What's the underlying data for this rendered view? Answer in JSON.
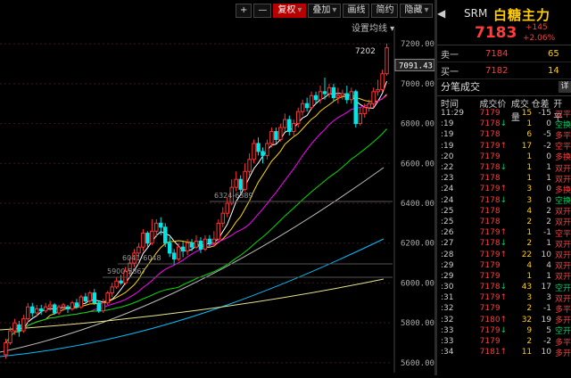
{
  "toolbar": {
    "plus": "+",
    "minus": "—",
    "fuquan": "复权",
    "diejia": "叠加",
    "huaxian": "画线",
    "jianyue": "简约",
    "yincang": "隐藏",
    "help": "?"
  },
  "chart": {
    "settings_label": "设置均线",
    "y_ticks": [
      "7200.00",
      "7000.00",
      "6800.00",
      "6600.00",
      "6400.00",
      "6200.00",
      "6000.00",
      "5800.00",
      "5600.00"
    ],
    "current_price_tag": "7091.43",
    "high_label": "7202",
    "annotations": [
      "6324-6389",
      "6041-6048",
      "5900-5867"
    ],
    "colors": {
      "up": "#ff3333",
      "down": "#00e5e5",
      "ma5": "#ffffff",
      "ma10": "#ffd700",
      "ma20": "#ff00ff",
      "ma60": "#00dd00",
      "ma120": "#bbbbbb",
      "ma250": "#00bfff",
      "ma500": "#e6e68c"
    }
  },
  "chart_data": {
    "type": "candlestick",
    "ylim": [
      5550,
      7250
    ],
    "candles": [
      [
        5640,
        5700,
        5620,
        5720
      ],
      [
        5700,
        5760,
        5690,
        5780
      ],
      [
        5760,
        5800,
        5740,
        5820
      ],
      [
        5790,
        5760,
        5730,
        5810
      ],
      [
        5760,
        5820,
        5750,
        5840
      ],
      [
        5820,
        5880,
        5800,
        5900
      ],
      [
        5880,
        5850,
        5830,
        5900
      ],
      [
        5850,
        5870,
        5830,
        5890
      ],
      [
        5870,
        5860,
        5840,
        5890
      ],
      [
        5860,
        5880,
        5850,
        5900
      ],
      [
        5880,
        5890,
        5860,
        5910
      ],
      [
        5890,
        5850,
        5840,
        5900
      ],
      [
        5850,
        5880,
        5840,
        5890
      ],
      [
        5880,
        5890,
        5860,
        5900
      ],
      [
        5880,
        5870,
        5850,
        5890
      ],
      [
        5870,
        5900,
        5860,
        5910
      ],
      [
        5900,
        5880,
        5870,
        5920
      ],
      [
        5880,
        5930,
        5870,
        5940
      ],
      [
        5930,
        5910,
        5900,
        5950
      ],
      [
        5910,
        5950,
        5900,
        5960
      ],
      [
        5950,
        5900,
        5890,
        5970
      ],
      [
        5900,
        5860,
        5850,
        5910
      ],
      [
        5860,
        5900,
        5850,
        5920
      ],
      [
        5900,
        5950,
        5890,
        5960
      ],
      [
        5950,
        5980,
        5930,
        6000
      ],
      [
        5980,
        6010,
        5970,
        6030
      ],
      [
        6010,
        6000,
        5990,
        6040
      ],
      [
        6000,
        6060,
        5990,
        6080
      ],
      [
        6060,
        6100,
        6040,
        6130
      ],
      [
        6100,
        6150,
        6080,
        6170
      ],
      [
        6150,
        6180,
        6130,
        6200
      ],
      [
        6180,
        6250,
        6160,
        6270
      ],
      [
        6250,
        6200,
        6180,
        6260
      ],
      [
        6200,
        6260,
        6190,
        6320
      ],
      [
        6260,
        6300,
        6230,
        6320
      ],
      [
        6300,
        6280,
        6240,
        6330
      ],
      [
        6280,
        6200,
        6180,
        6300
      ],
      [
        6200,
        6150,
        6130,
        6230
      ],
      [
        6150,
        6120,
        6090,
        6170
      ],
      [
        6120,
        6180,
        6110,
        6200
      ],
      [
        6180,
        6160,
        6130,
        6210
      ],
      [
        6160,
        6200,
        6140,
        6220
      ],
      [
        6200,
        6180,
        6160,
        6220
      ],
      [
        6180,
        6210,
        6170,
        6240
      ],
      [
        6210,
        6170,
        6150,
        6230
      ],
      [
        6170,
        6220,
        6160,
        6240
      ],
      [
        6220,
        6200,
        6180,
        6240
      ],
      [
        6200,
        6220,
        6180,
        6260
      ],
      [
        6220,
        6300,
        6210,
        6320
      ],
      [
        6300,
        6350,
        6280,
        6380
      ],
      [
        6350,
        6400,
        6330,
        6430
      ],
      [
        6400,
        6480,
        6390,
        6520
      ],
      [
        6480,
        6520,
        6460,
        6560
      ],
      [
        6520,
        6470,
        6450,
        6540
      ],
      [
        6470,
        6560,
        6460,
        6600
      ],
      [
        6560,
        6620,
        6540,
        6650
      ],
      [
        6620,
        6700,
        6600,
        6720
      ],
      [
        6700,
        6660,
        6640,
        6730
      ],
      [
        6660,
        6640,
        6600,
        6680
      ],
      [
        6640,
        6700,
        6620,
        6720
      ],
      [
        6700,
        6760,
        6680,
        6780
      ],
      [
        6760,
        6720,
        6700,
        6780
      ],
      [
        6720,
        6780,
        6710,
        6800
      ],
      [
        6780,
        6820,
        6760,
        6850
      ],
      [
        6820,
        6760,
        6740,
        6840
      ],
      [
        6760,
        6800,
        6740,
        6820
      ],
      [
        6800,
        6860,
        6780,
        6880
      ],
      [
        6860,
        6900,
        6840,
        6920
      ],
      [
        6900,
        6880,
        6860,
        6930
      ],
      [
        6880,
        6940,
        6870,
        6960
      ],
      [
        6940,
        6920,
        6900,
        6960
      ],
      [
        6920,
        6960,
        6900,
        6990
      ],
      [
        6960,
        6950,
        6920,
        7030
      ],
      [
        6950,
        6980,
        6930,
        7000
      ],
      [
        6980,
        6930,
        6910,
        7000
      ],
      [
        6930,
        6940,
        6900,
        6980
      ],
      [
        6940,
        6950,
        6920,
        6970
      ],
      [
        6950,
        6920,
        6900,
        6990
      ],
      [
        6920,
        6960,
        6900,
        6980
      ],
      [
        6960,
        6800,
        6780,
        6970
      ],
      [
        6800,
        6850,
        6790,
        6880
      ],
      [
        6850,
        6880,
        6830,
        6900
      ],
      [
        6880,
        6900,
        6860,
        6920
      ],
      [
        6900,
        6960,
        6880,
        6980
      ],
      [
        6960,
        6970,
        6940,
        7020
      ],
      [
        6970,
        7050,
        6960,
        7070
      ],
      [
        7050,
        7180,
        7040,
        7202
      ]
    ]
  },
  "quote": {
    "code": "SRM",
    "name": "白糖主力",
    "price": "7183",
    "change": "+145",
    "change_pct": "+2.06%",
    "ask_label": "卖一",
    "ask_price": "7184",
    "ask_vol": "65",
    "bid_label": "买一",
    "bid_price": "7182",
    "bid_vol": "14",
    "ticks_title": "分笔成交",
    "detail_btn": "详",
    "cols": [
      "时间",
      "成交价",
      "成交量",
      "仓差",
      "开平"
    ],
    "rows": [
      {
        "t": "11:29",
        "p": "7179",
        "a": "",
        "v": "15",
        "oi": "-15",
        "k": "双平",
        "g": false
      },
      {
        "t": ":19",
        "p": "7178",
        "a": "↓",
        "v": "1",
        "oi": "0",
        "k": "空换",
        "g": true
      },
      {
        "t": ":19",
        "p": "7178",
        "a": "",
        "v": "6",
        "oi": "-5",
        "k": "多平",
        "g": false
      },
      {
        "t": ":19",
        "p": "7179",
        "a": "↑",
        "v": "17",
        "oi": "-2",
        "k": "空平",
        "g": false
      },
      {
        "t": ":20",
        "p": "7179",
        "a": "",
        "v": "1",
        "oi": "0",
        "k": "多换",
        "g": false
      },
      {
        "t": ":22",
        "p": "7178",
        "a": "↓",
        "v": "1",
        "oi": "1",
        "k": "双开",
        "g": false
      },
      {
        "t": ":23",
        "p": "7178",
        "a": "",
        "v": "1",
        "oi": "1",
        "k": "双开",
        "g": false
      },
      {
        "t": ":24",
        "p": "7179",
        "a": "↑",
        "v": "3",
        "oi": "0",
        "k": "多换",
        "g": false
      },
      {
        "t": ":24",
        "p": "7178",
        "a": "↓",
        "v": "3",
        "oi": "0",
        "k": "空换",
        "g": true
      },
      {
        "t": ":25",
        "p": "7178",
        "a": "",
        "v": "4",
        "oi": "2",
        "k": "双开",
        "g": false
      },
      {
        "t": ":25",
        "p": "7178",
        "a": "",
        "v": "2",
        "oi": "2",
        "k": "双开",
        "g": false
      },
      {
        "t": ":26",
        "p": "7179",
        "a": "↑",
        "v": "1",
        "oi": "-1",
        "k": "空平",
        "g": false
      },
      {
        "t": ":27",
        "p": "7178",
        "a": "↓",
        "v": "2",
        "oi": "1",
        "k": "双开",
        "g": false
      },
      {
        "t": ":28",
        "p": "7179",
        "a": "↑",
        "v": "22",
        "oi": "10",
        "k": "双开",
        "g": false
      },
      {
        "t": ":29",
        "p": "7179",
        "a": "",
        "v": "4",
        "oi": "4",
        "k": "双开",
        "g": false
      },
      {
        "t": ":29",
        "p": "7179",
        "a": "",
        "v": "1",
        "oi": "1",
        "k": "双开",
        "g": false
      },
      {
        "t": ":30",
        "p": "7178",
        "a": "↓",
        "v": "43",
        "oi": "17",
        "k": "空开",
        "g": true
      },
      {
        "t": ":31",
        "p": "7179",
        "a": "↑",
        "v": "3",
        "oi": "3",
        "k": "双开",
        "g": false
      },
      {
        "t": ":32",
        "p": "7179",
        "a": "",
        "v": "2",
        "oi": "-1",
        "k": "多平",
        "g": false
      },
      {
        "t": ":32",
        "p": "7180",
        "a": "↑",
        "v": "32",
        "oi": "19",
        "k": "多开",
        "g": false
      },
      {
        "t": ":33",
        "p": "7179",
        "a": "↓",
        "v": "9",
        "oi": "5",
        "k": "空开",
        "g": true
      },
      {
        "t": ":33",
        "p": "7179",
        "a": "",
        "v": "2",
        "oi": "-2",
        "k": "多平",
        "g": false
      },
      {
        "t": ":34",
        "p": "7181",
        "a": "↑",
        "v": "11",
        "oi": "10",
        "k": "多开",
        "g": false
      }
    ]
  }
}
